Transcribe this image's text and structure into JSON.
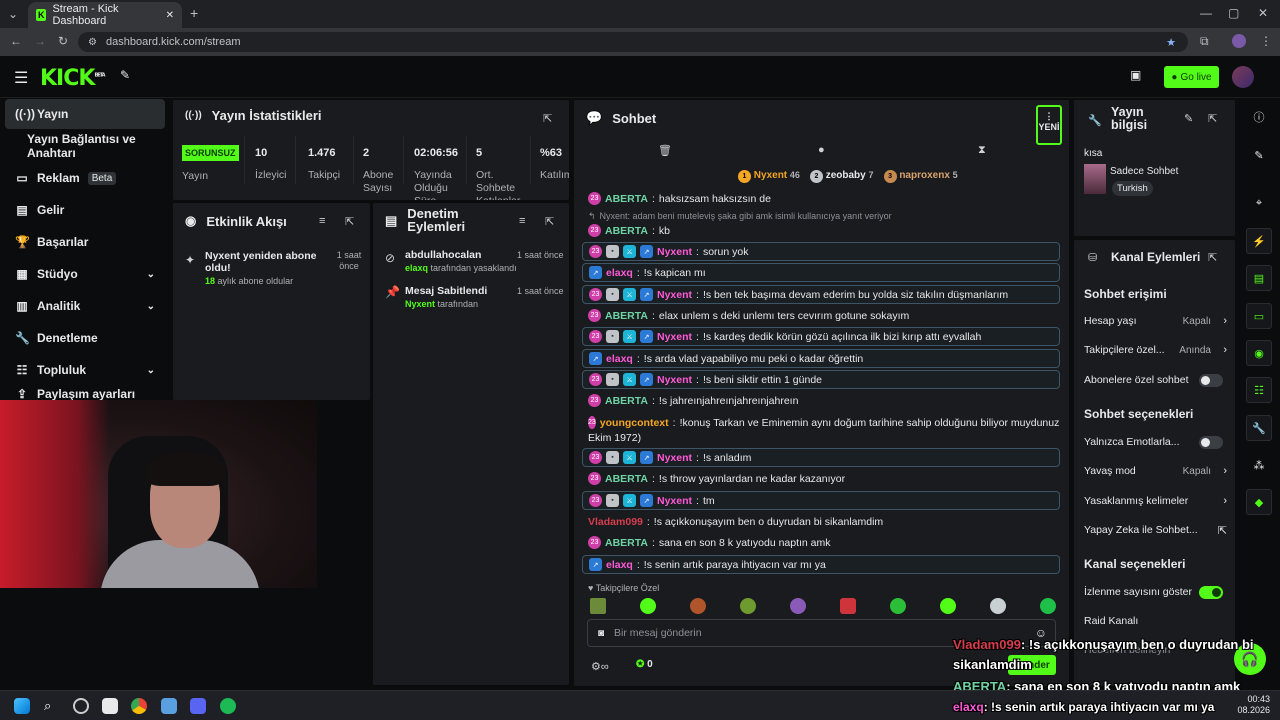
{
  "browser": {
    "tab_title": "Stream - Kick Dashboard",
    "url": "dashboard.kick.com/stream"
  },
  "topbar": {
    "logo": "KICK",
    "logo_sup": "BETA",
    "go_live": "Go live"
  },
  "nav": {
    "items": [
      {
        "label": "Yayın"
      },
      {
        "label": "Yayın Bağlantısı ve Anahtarı"
      },
      {
        "label": "Reklam",
        "badge": "Beta"
      },
      {
        "label": "Gelir"
      },
      {
        "label": "Başarılar"
      },
      {
        "label": "Stüdyo"
      },
      {
        "label": "Analitik"
      },
      {
        "label": "Denetleme"
      },
      {
        "label": "Topluluk"
      },
      {
        "label": "Paylaşım ayarları"
      }
    ]
  },
  "stats": {
    "title": "Yayın İstatistikleri",
    "status_badge": "SORUNSUZ",
    "items": [
      {
        "value": "",
        "label": "Yayın"
      },
      {
        "value": "10",
        "label": "İzleyici"
      },
      {
        "value": "1.476",
        "label": "Takipçi"
      },
      {
        "value": "2",
        "label": "Abone Sayısı"
      },
      {
        "value": "02:06:56",
        "label": "Yayında Olduğu Süre"
      },
      {
        "value": "5",
        "label": "Ort. Sohbete Katılanlar"
      },
      {
        "value": "%63",
        "label": "Katılım"
      }
    ]
  },
  "activity": {
    "title": "Etkinlik Akışı",
    "event_title": "Nyxent yeniden abone oldu!",
    "event_months": "18",
    "event_sub": "aylık abone oldular",
    "event_time": "1 saat önce"
  },
  "moderation": {
    "title": "Denetim Eylemleri",
    "entries": [
      {
        "user": "abdullahocalan",
        "actor": "elaxq",
        "action": "tarafından yasaklandı",
        "time": "1 saat önce"
      },
      {
        "user": "Mesaj Sabitlendi",
        "actor": "Nyxent",
        "action": "tarafından",
        "time": "1 saat önce"
      }
    ]
  },
  "chat": {
    "title": "Sohbet",
    "new_label": "YENİ",
    "top_chatters": [
      {
        "rank": "1",
        "name": "Nyxent",
        "count": "46"
      },
      {
        "rank": "2",
        "name": "zeobaby",
        "count": "7"
      },
      {
        "rank": "3",
        "name": "naproxenx",
        "count": "5"
      }
    ],
    "reply_note": "Nyxent: adam beni muteleviş şaka gibi amk isimli kullanıcıya yanıt veriyor",
    "messages": [
      {
        "user": "ABERTA",
        "text": "haksızsam haksızsın de"
      },
      {
        "user": "ABERTA",
        "text": "kb"
      },
      {
        "user": "Nyxent",
        "text": "sorun yok"
      },
      {
        "user": "elaxq",
        "text": "!s kapican mı"
      },
      {
        "user": "Nyxent",
        "text": "!s ben tek başıma devam ederim bu yolda siz takılın düşmanlarım"
      },
      {
        "user": "ABERTA",
        "text": "elax unlem s deki unlemı ters cevırım gotune sokayım"
      },
      {
        "user": "Nyxent",
        "text": "!s kardeş dedik körün gözü açılınca ilk bizi kırıp attı eyvallah"
      },
      {
        "user": "elaxq",
        "text": "!s arda vlad yapabiliyo mu peki o kadar öğrettin"
      },
      {
        "user": "Nyxent",
        "text": "!s beni siktir ettin 1 günde"
      },
      {
        "user": "ABERTA",
        "text": "!s jahreınjahreınjahreınjahreın"
      },
      {
        "user": "youngcontext",
        "text": "!konuş Tarkan ve Eminemin aynı doğum tarihine sahip olduğunu biliyor muydunuz (17"
      },
      {
        "user": "",
        "text": "Ekim 1972)"
      },
      {
        "user": "Nyxent",
        "text": "!s anladım"
      },
      {
        "user": "ABERTA",
        "text": "!s throw yayınlardan ne kadar kazanıyor"
      },
      {
        "user": "Nyxent",
        "text": "tm"
      },
      {
        "user": "Vladam099",
        "text": "!s açıkkonuşayım ben o duyrudan bi sikanlamdim"
      },
      {
        "user": "ABERTA",
        "text": "sana en son 8 k yatıyodu naptın amk"
      },
      {
        "user": "elaxq",
        "text": "!s senin artık paraya ihtiyacın var mı ya"
      }
    ],
    "followers_only": "Takipçilere Özel",
    "input_placeholder": "Bir mesaj gönderin",
    "points": "0",
    "send": "Gönder"
  },
  "stream_info": {
    "title": "Yayın bilgisi",
    "title_value": "kısa",
    "category": "Sadece Sohbet",
    "tag": "Turkish"
  },
  "channel_actions": {
    "title": "Kanal Eylemleri",
    "chat_access": "Sohbet erişimi",
    "account_age": "Hesap yaşı",
    "account_age_val": "Kapalı",
    "followers": "Takipçilere özel...",
    "followers_val": "Anında",
    "subs_only": "Abonelere özel sohbet",
    "chat_options": "Sohbet seçenekleri",
    "emotes_only": "Yalnızca Emotlarla...",
    "slow_mode": "Yavaş mod",
    "slow_mode_val": "Kapalı",
    "banned_words": "Yasaklanmış kelimeler",
    "ai_chat": "Yapay Zeka ile Sohbet...",
    "channel_options": "Kanal seçenekleri",
    "show_views": "İzlenme sayısını göster",
    "raid": "Raid Kanalı",
    "host": "Hedefleri belirleyin"
  },
  "overlay": [
    {
      "user": "Vladam099",
      "text": ": !s açıkkonuşayım ben o duyrudan bi"
    },
    {
      "user": "",
      "text": "sikanlamdim"
    },
    {
      "user": "ABERTA",
      "text": ": sana en son 8 k yatıyodu naptın amk"
    },
    {
      "user": "elaxq",
      "text": ": !s senin artık paraya ihtiyacın var mı ya"
    }
  ],
  "taskbar": {
    "time": "00:43",
    "date": "08.2026"
  },
  "colors": {
    "accent": "#53fc18",
    "bg": "#0b0c0d",
    "panel": "#191b1f"
  }
}
